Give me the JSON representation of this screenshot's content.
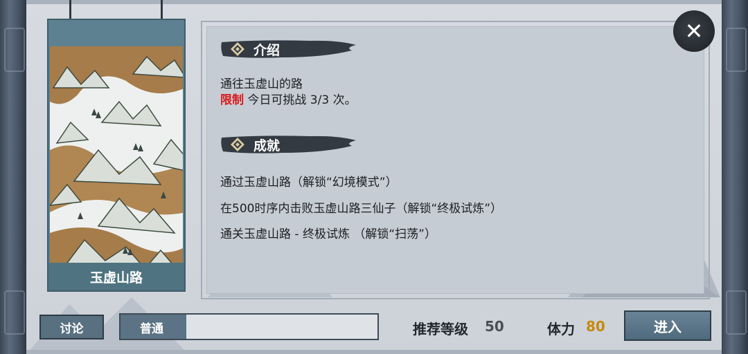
{
  "banner": {
    "title": "玉虚山路"
  },
  "intro": {
    "header": "介绍",
    "description": "通往玉虚山的路",
    "limit_tag": "限制",
    "limit_text": "今日可挑战 3/3 次。"
  },
  "achievements": {
    "header": "成就",
    "items": [
      "通过玉虚山路（解锁“幻境模式”）",
      "在500时序内击败玉虚山路三仙子（解锁“终极试炼”）",
      "通关玉虚山路 - 终极试炼 （解锁“扫荡”）"
    ]
  },
  "footer": {
    "discuss_label": "讨论",
    "difficulty_label": "普通",
    "recommended_level_label": "推荐等级",
    "recommended_level_value": "50",
    "stamina_label": "体力",
    "stamina_value": "80",
    "enter_label": "进入"
  },
  "close": {
    "glyph": "✕"
  },
  "icons": {
    "close": "close-icon",
    "section_emblem": "diamond-emblem-icon"
  },
  "colors": {
    "limit_red": "#d71b1b",
    "level_value": "#4a4f55",
    "stamina_value": "#c58a12",
    "banner_teal": "#5b7f8d"
  }
}
